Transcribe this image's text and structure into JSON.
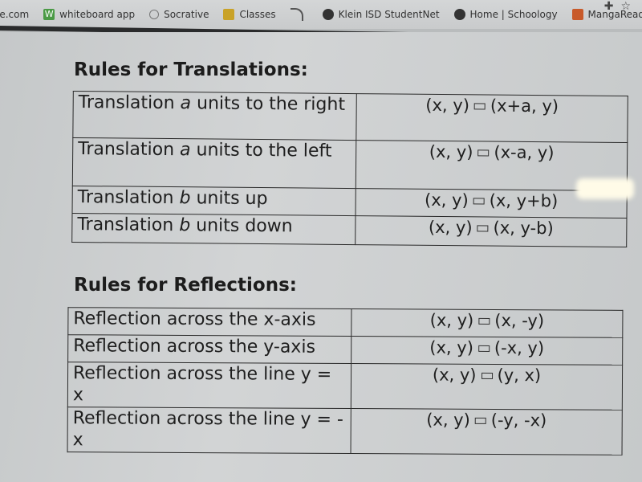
{
  "bookmarks": [
    {
      "label": "le.com",
      "icon": "page-icon"
    },
    {
      "label": "whiteboard app",
      "icon": "w-logo-icon"
    },
    {
      "label": "Socrative",
      "icon": "socrative-icon"
    },
    {
      "label": "Classes",
      "icon": "classroom-icon"
    },
    {
      "label": "",
      "icon": "signal-icon"
    },
    {
      "label": "Klein ISD StudentNet",
      "icon": "globe-icon"
    },
    {
      "label": "Home | Schoology",
      "icon": "schoology-icon"
    },
    {
      "label": "MangaReader.site -...",
      "icon": "manga-icon"
    }
  ],
  "toolbar_icons": {
    "extension": "extension-icon",
    "star": "star-icon"
  },
  "translations": {
    "title": "Rules for Translations:",
    "rows": [
      {
        "desc_pre": "Translation ",
        "var": "a",
        "desc_post": " units to the right",
        "from": "(x, y)",
        "to": "(x+a, y)"
      },
      {
        "desc_pre": "Translation ",
        "var": "a",
        "desc_post": " units to the left",
        "from": "(x, y)",
        "to": "(x-a, y)"
      },
      {
        "desc_pre": "Translation ",
        "var": "b",
        "desc_post": " units up",
        "from": "(x, y)",
        "to": "(x, y+b)"
      },
      {
        "desc_pre": "Translation ",
        "var": "b",
        "desc_post": " units down",
        "from": "(x, y)",
        "to": "(x, y-b)"
      }
    ]
  },
  "reflections": {
    "title": "Rules for Reflections:",
    "rows": [
      {
        "desc": "Reflection across the x-axis",
        "from": "(x, y)",
        "to": "(x, -y)"
      },
      {
        "desc": "Reflection across the y-axis",
        "from": "(x, y)",
        "to": "(-x, y)"
      },
      {
        "desc": "Reflection across the line y = x",
        "from": "(x, y)",
        "to": "(y, x)"
      },
      {
        "desc": "Reflection across the line y = -x",
        "from": "(x, y)",
        "to": "(-y, -x)"
      }
    ]
  }
}
